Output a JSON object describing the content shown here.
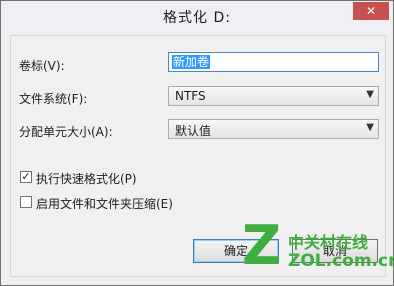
{
  "window": {
    "title": "格式化 D:",
    "close_glyph": "✕"
  },
  "form": {
    "volume_label": {
      "label": "卷标(V):",
      "value": "新加卷"
    },
    "file_system": {
      "label": "文件系统(F):",
      "selected": "NTFS"
    },
    "allocation_unit": {
      "label": "分配单元大小(A):",
      "selected": "默认值"
    },
    "quick_format": {
      "label": "执行快速格式化(P)",
      "checked": true,
      "check_glyph": "✓"
    },
    "compression": {
      "label": "启用文件和文件夹压缩(E)",
      "checked": false
    }
  },
  "buttons": {
    "ok_label": "确定",
    "cancel_label": "取消"
  },
  "watermark": {
    "logo_letter": "Z",
    "brand_cn": "中关村在线",
    "brand_en": "ZOL.com.cn"
  },
  "colors": {
    "close_button": "#c75050",
    "selection": "#3399ff",
    "watermark": "#3fae3f"
  },
  "icons": {
    "dropdown": "▼"
  }
}
